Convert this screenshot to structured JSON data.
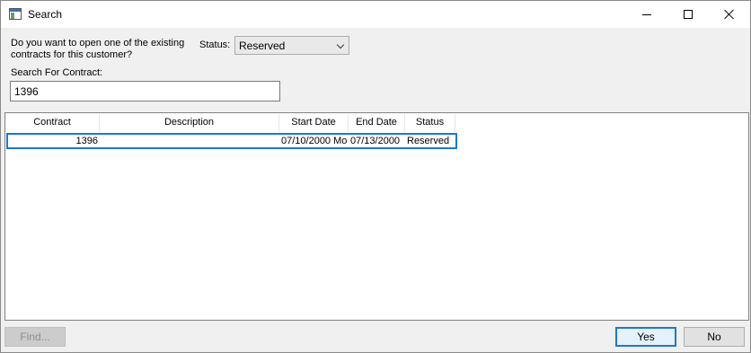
{
  "window": {
    "title": "Search",
    "icon": "app-window-icon"
  },
  "form": {
    "prompt": "Do you want to open one of the existing contracts for this customer?",
    "status_label": "Status:",
    "status_value": "Reserved",
    "search_label": "Search For Contract:",
    "search_value": "1396"
  },
  "grid": {
    "columns": [
      "Contract",
      "Description",
      "Start Date",
      "End Date",
      "Status"
    ],
    "rows": [
      {
        "contract": "1396",
        "description": "",
        "start_date": "07/10/2000 Mo",
        "end_date": "07/13/2000",
        "status": "Reserved"
      }
    ]
  },
  "buttons": {
    "find": "Find...",
    "yes": "Yes",
    "no": "No"
  },
  "colors": {
    "accent": "#1e78c8",
    "dialog_bg": "#f0f0f0"
  }
}
